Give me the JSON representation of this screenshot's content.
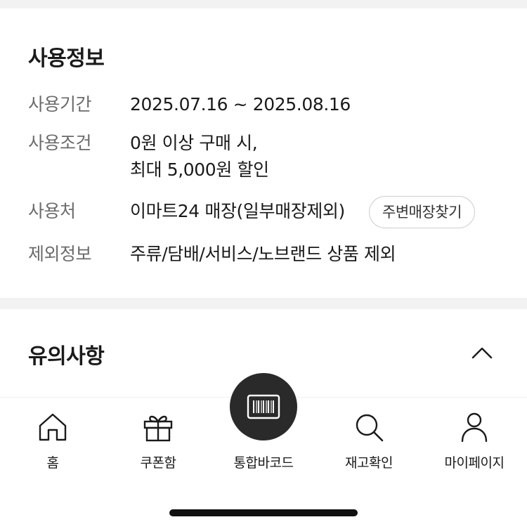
{
  "usage_info": {
    "title": "사용정보",
    "rows": [
      {
        "label": "사용기간",
        "value": "2025.07.16 ~ 2025.08.16"
      },
      {
        "label": "사용조건",
        "value": "0원 이상 구매 시,",
        "value2": "최대 5,000원 할인"
      },
      {
        "label": "사용처",
        "value": "이마트24 매장(일부매장제외)",
        "button": "주변매장찾기"
      },
      {
        "label": "제외정보",
        "value": "주류/담배/서비스/노브랜드 상품 제외"
      }
    ]
  },
  "notice": {
    "title": "유의사항",
    "toggle_icon": "chevron-up-icon"
  },
  "bottom_nav": {
    "items": [
      {
        "label": "홈",
        "icon": "home-icon"
      },
      {
        "label": "쿠폰함",
        "icon": "gift-icon"
      },
      {
        "label": "통합바코드",
        "icon": "barcode-icon"
      },
      {
        "label": "재고확인",
        "icon": "search-icon"
      },
      {
        "label": "마이페이지",
        "icon": "person-icon"
      }
    ]
  },
  "colors": {
    "text_primary": "#1a1a1a",
    "text_secondary": "#6b6b6b",
    "fab_background": "#2a2a2a",
    "divider": "#f2f2f2"
  }
}
